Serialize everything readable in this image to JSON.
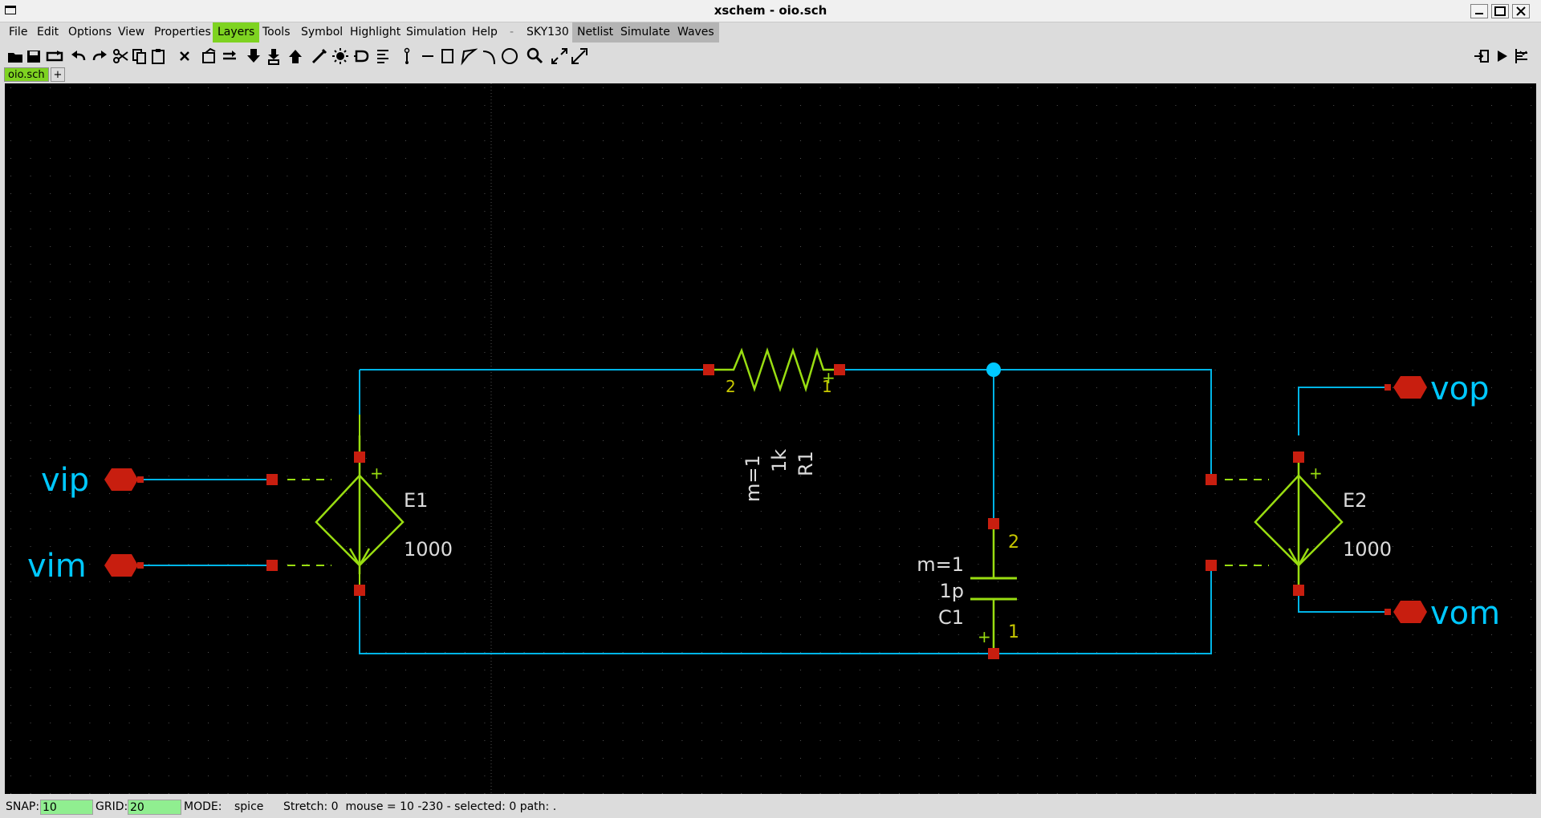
{
  "window": {
    "title": "xschem - oio.sch"
  },
  "menu": [
    "File",
    "Edit",
    "Options",
    "View",
    "Properties",
    "Layers",
    "Tools",
    "Symbol",
    "Highlight",
    "Simulation",
    "Help",
    "-",
    "SKY130",
    "Netlist",
    "Simulate",
    "Waves"
  ],
  "menu_active": "Layers",
  "toolbar_icons": [
    "open-icon",
    "save-icon",
    "reload-icon",
    "undo-icon",
    "redo-icon",
    "cut-icon",
    "copy-icon",
    "paste-icon",
    "delete-icon",
    "netlist-icon",
    "swap-icon",
    "descend-icon",
    "descend-symbol-icon",
    "ascend-icon",
    "wire-icon",
    "highlight-icon",
    "insert-symbol-icon",
    "text-icon",
    "probe-icon",
    "line-icon",
    "rect-icon",
    "polygon-icon",
    "arc-icon",
    "circle-icon",
    "zoom-icon",
    "zoom-in-icon",
    "zoom-fit-icon"
  ],
  "toolbar_right_icons": [
    "export-icon",
    "run-icon",
    "waves-icon"
  ],
  "tabs": {
    "current": "oio.sch",
    "add": "+"
  },
  "colors": {
    "wire": "#00b4e6",
    "symbol": "#99dd11",
    "pin": "#c81e0f",
    "label_text": "#00c8ff",
    "attr_text": "#dcdcdc",
    "pin_number": "#c8c800"
  },
  "schematic": {
    "ports": {
      "vip": "vip",
      "vim": "vim",
      "vop": "vop",
      "vom": "vom"
    },
    "e1": {
      "name": "E1",
      "value": "1000",
      "plus": "+"
    },
    "e2": {
      "name": "E2",
      "value": "1000",
      "plus": "+"
    },
    "r1": {
      "name": "R1",
      "value": "1k",
      "mult": "m=1",
      "pin1": "1",
      "pin2": "2",
      "plus": "+"
    },
    "c1": {
      "name": "C1",
      "value": "1p",
      "mult": "m=1",
      "pin1": "1",
      "pin2": "2",
      "plus": "+"
    }
  },
  "status": {
    "snap_label": "SNAP:",
    "snap": "10",
    "grid_label": "GRID:",
    "grid": "20",
    "mode_label": "MODE:",
    "mode": "spice",
    "info": "Stretch: 0  mouse = 10 -230 - selected: 0 path: ."
  }
}
